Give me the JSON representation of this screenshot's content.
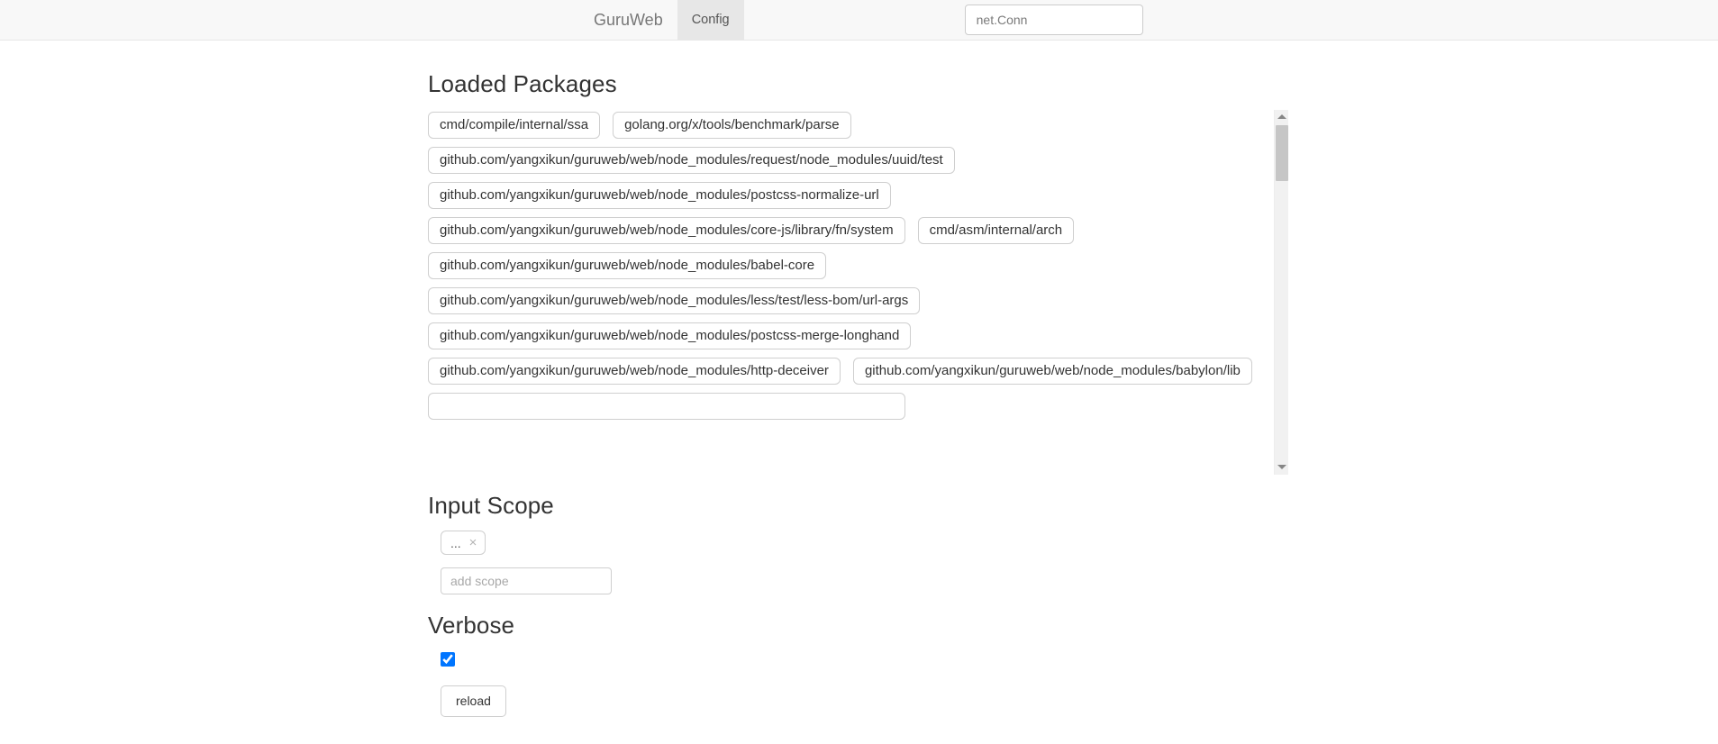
{
  "navbar": {
    "brand": "GuruWeb",
    "tabs": [
      {
        "label": "Config",
        "active": true
      }
    ],
    "search": {
      "value": "net.Conn",
      "placeholder": ""
    }
  },
  "packages_section": {
    "title": "Loaded Packages",
    "items": [
      "cmd/compile/internal/ssa",
      "golang.org/x/tools/benchmark/parse",
      "github.com/yangxikun/guruweb/web/node_modules/request/node_modules/uuid/test",
      "github.com/yangxikun/guruweb/web/node_modules/postcss-normalize-url",
      "github.com/yangxikun/guruweb/web/node_modules/core-js/library/fn/system",
      "cmd/asm/internal/arch",
      "github.com/yangxikun/guruweb/web/node_modules/babel-core",
      "github.com/yangxikun/guruweb/web/node_modules/less/test/less-bom/url-args",
      "github.com/yangxikun/guruweb/web/node_modules/postcss-merge-longhand",
      "github.com/yangxikun/guruweb/web/node_modules/http-deceiver",
      "github.com/yangxikun/guruweb/web/node_modules/babylon/lib",
      ""
    ]
  },
  "scope_section": {
    "title": "Input Scope",
    "tags": [
      {
        "label": "...",
        "remove": "×"
      }
    ],
    "add_input": {
      "value": "",
      "placeholder": "add scope"
    }
  },
  "verbose_section": {
    "title": "Verbose",
    "checked": true
  },
  "actions": {
    "reload_label": "reload"
  },
  "colors": {
    "navbar_bg": "#f8f8f8",
    "navbar_border": "#e7e7e7",
    "tab_active_bg": "#e7e7e7",
    "tag_border": "#cfcfcf",
    "text": "#333333",
    "muted": "#777777"
  }
}
